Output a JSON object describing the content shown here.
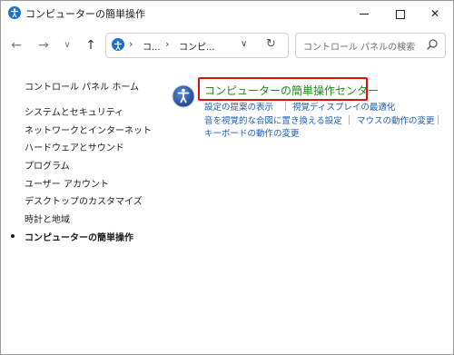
{
  "window": {
    "title": "コンピューターの簡単操作"
  },
  "address": {
    "crumbs": [
      "コ...",
      "コンピ..."
    ]
  },
  "search": {
    "placeholder": "コントロール パネルの検索"
  },
  "sidebar": {
    "items": [
      {
        "label": "コントロール パネル ホーム"
      },
      {
        "label": "システムとセキュリティ"
      },
      {
        "label": "ネットワークとインターネット"
      },
      {
        "label": "ハードウェアとサウンド"
      },
      {
        "label": "プログラム"
      },
      {
        "label": "ユーザー アカウント"
      },
      {
        "label": "デスクトップのカスタマイズ"
      },
      {
        "label": "時計と地域"
      },
      {
        "label": "コンピューターの簡単操作"
      }
    ]
  },
  "main": {
    "title": "コンピューターの簡単操作センター",
    "links": [
      {
        "label": "設定の提案の表示"
      },
      {
        "label": "視覚ディスプレイの最適化"
      },
      {
        "label": "音を視覚的な合図に置き換える設定"
      },
      {
        "label": "マウスの動作の変更"
      },
      {
        "label": "キーボードの動作の変更"
      }
    ]
  },
  "colors": {
    "title_green": "#1e8a1e",
    "link_blue": "#1a5fb4",
    "highlight_red": "#e01010",
    "accent_blue": "#1a6fd4"
  }
}
